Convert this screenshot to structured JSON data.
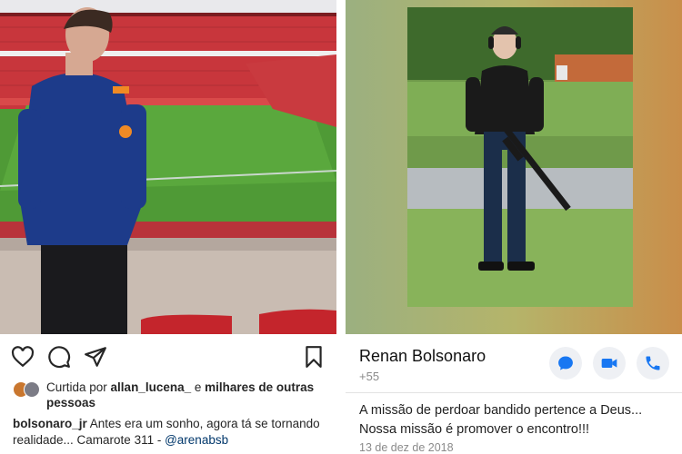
{
  "instagram": {
    "liked_by_prefix": "Curtida por ",
    "liked_by_user": "allan_lucena_",
    "liked_by_middle": " e ",
    "liked_by_rest": "milhares de outras pessoas",
    "caption_user": "bolsonaro_jr",
    "caption_text": " Antes era um sonho, agora tá se tornando realidade... Camarote 311 - ",
    "caption_mention": "@arenabsb",
    "icons": [
      "heart-icon",
      "comment-icon",
      "share-icon",
      "bookmark-icon"
    ]
  },
  "whatsapp": {
    "contact_name": "Renan Bolsonaro",
    "phone": "+55",
    "status_text": "A missão de perdoar bandido pertence a Deus... Nossa missão é promover o encontro!!!",
    "status_date": "13 de dez de 2018",
    "accent_color": "#1877f2",
    "icons": [
      "message-icon",
      "video-call-icon",
      "phone-icon"
    ]
  }
}
